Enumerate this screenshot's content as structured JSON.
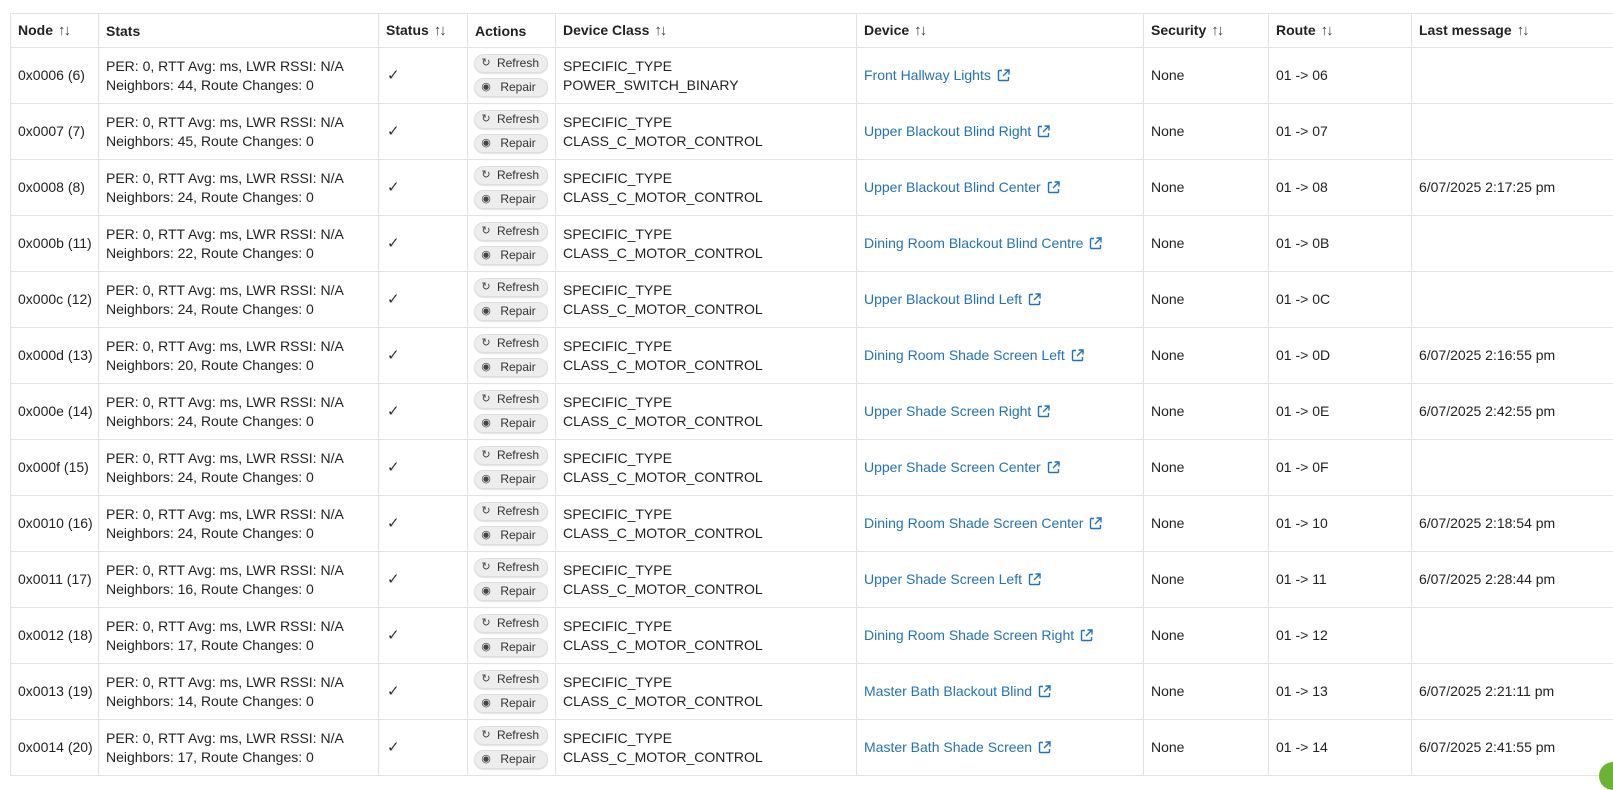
{
  "headers": {
    "node": "Node",
    "stats": "Stats",
    "status": "Status",
    "actions": "Actions",
    "device_class": "Device Class",
    "device": "Device",
    "security": "Security",
    "route": "Route",
    "last_message": "Last message",
    "sort_glyph": "↑↓"
  },
  "buttons": {
    "refresh": "Refresh",
    "repair": "Repair",
    "refresh_icon": "refresh-icon",
    "repair_icon": "repair-icon"
  },
  "rows": [
    {
      "node": "0x0006 (6)",
      "stats1": "PER: 0, RTT Avg: ms, LWR RSSI: N/A",
      "stats2": "Neighbors: 44, Route Changes: 0",
      "status": "✓",
      "device_class": "SPECIFIC_TYPE POWER_SWITCH_BINARY",
      "device": "Front Hallway Lights",
      "security": "None",
      "route": "01 -> 06",
      "last_message": ""
    },
    {
      "node": "0x0007 (7)",
      "stats1": "PER: 0, RTT Avg: ms, LWR RSSI: N/A",
      "stats2": "Neighbors: 45, Route Changes: 0",
      "status": "✓",
      "device_class": "SPECIFIC_TYPE CLASS_C_MOTOR_CONTROL",
      "device": "Upper Blackout Blind Right",
      "security": "None",
      "route": "01 -> 07",
      "last_message": ""
    },
    {
      "node": "0x0008 (8)",
      "stats1": "PER: 0, RTT Avg: ms, LWR RSSI: N/A",
      "stats2": "Neighbors: 24, Route Changes: 0",
      "status": "✓",
      "device_class": "SPECIFIC_TYPE CLASS_C_MOTOR_CONTROL",
      "device": "Upper Blackout Blind Center",
      "security": "None",
      "route": "01 -> 08",
      "last_message": "6/07/2025 2:17:25 pm"
    },
    {
      "node": "0x000b (11)",
      "stats1": "PER: 0, RTT Avg: ms, LWR RSSI: N/A",
      "stats2": "Neighbors: 22, Route Changes: 0",
      "status": "✓",
      "device_class": "SPECIFIC_TYPE CLASS_C_MOTOR_CONTROL",
      "device": "Dining Room Blackout Blind Centre",
      "security": "None",
      "route": "01 -> 0B",
      "last_message": ""
    },
    {
      "node": "0x000c (12)",
      "stats1": "PER: 0, RTT Avg: ms, LWR RSSI: N/A",
      "stats2": "Neighbors: 24, Route Changes: 0",
      "status": "✓",
      "device_class": "SPECIFIC_TYPE CLASS_C_MOTOR_CONTROL",
      "device": "Upper Blackout Blind Left",
      "security": "None",
      "route": "01 -> 0C",
      "last_message": ""
    },
    {
      "node": "0x000d (13)",
      "stats1": "PER: 0, RTT Avg: ms, LWR RSSI: N/A",
      "stats2": "Neighbors: 20, Route Changes: 0",
      "status": "✓",
      "device_class": "SPECIFIC_TYPE CLASS_C_MOTOR_CONTROL",
      "device": "Dining Room Shade Screen Left",
      "security": "None",
      "route": "01 -> 0D",
      "last_message": "6/07/2025 2:16:55 pm"
    },
    {
      "node": "0x000e (14)",
      "stats1": "PER: 0, RTT Avg: ms, LWR RSSI: N/A",
      "stats2": "Neighbors: 24, Route Changes: 0",
      "status": "✓",
      "device_class": "SPECIFIC_TYPE CLASS_C_MOTOR_CONTROL",
      "device": "Upper Shade Screen Right",
      "security": "None",
      "route": "01 -> 0E",
      "last_message": "6/07/2025 2:42:55 pm"
    },
    {
      "node": "0x000f (15)",
      "stats1": "PER: 0, RTT Avg: ms, LWR RSSI: N/A",
      "stats2": "Neighbors: 24, Route Changes: 0",
      "status": "✓",
      "device_class": "SPECIFIC_TYPE CLASS_C_MOTOR_CONTROL",
      "device": "Upper Shade Screen Center",
      "security": "None",
      "route": "01 -> 0F",
      "last_message": ""
    },
    {
      "node": "0x0010 (16)",
      "stats1": "PER: 0, RTT Avg: ms, LWR RSSI: N/A",
      "stats2": "Neighbors: 24, Route Changes: 0",
      "status": "✓",
      "device_class": "SPECIFIC_TYPE CLASS_C_MOTOR_CONTROL",
      "device": "Dining Room Shade Screen Center",
      "security": "None",
      "route": "01 -> 10",
      "last_message": "6/07/2025 2:18:54 pm"
    },
    {
      "node": "0x0011 (17)",
      "stats1": "PER: 0, RTT Avg: ms, LWR RSSI: N/A",
      "stats2": "Neighbors: 16, Route Changes: 0",
      "status": "✓",
      "device_class": "SPECIFIC_TYPE CLASS_C_MOTOR_CONTROL",
      "device": "Upper Shade Screen Left",
      "security": "None",
      "route": "01 -> 11",
      "last_message": "6/07/2025 2:28:44 pm"
    },
    {
      "node": "0x0012 (18)",
      "stats1": "PER: 0, RTT Avg: ms, LWR RSSI: N/A",
      "stats2": "Neighbors: 17, Route Changes: 0",
      "status": "✓",
      "device_class": "SPECIFIC_TYPE CLASS_C_MOTOR_CONTROL",
      "device": "Dining Room Shade Screen Right",
      "security": "None",
      "route": "01 -> 12",
      "last_message": ""
    },
    {
      "node": "0x0013 (19)",
      "stats1": "PER: 0, RTT Avg: ms, LWR RSSI: N/A",
      "stats2": "Neighbors: 14, Route Changes: 0",
      "status": "✓",
      "device_class": "SPECIFIC_TYPE CLASS_C_MOTOR_CONTROL",
      "device": "Master Bath Blackout Blind",
      "security": "None",
      "route": "01 -> 13",
      "last_message": "6/07/2025 2:21:11 pm"
    },
    {
      "node": "0x0014 (20)",
      "stats1": "PER: 0, RTT Avg: ms, LWR RSSI: N/A",
      "stats2": "Neighbors: 17, Route Changes: 0",
      "status": "✓",
      "device_class": "SPECIFIC_TYPE CLASS_C_MOTOR_CONTROL",
      "device": "Master Bath Shade Screen",
      "security": "None",
      "route": "01 -> 14",
      "last_message": "6/07/2025 2:41:55 pm"
    }
  ],
  "colors": {
    "link": "#1e73be",
    "border": "#e2e2e2",
    "button_bg": "#ededed",
    "corner_badge": "#69b533"
  },
  "icons": {
    "external_link": "external-link-icon",
    "status": "check-icon"
  }
}
